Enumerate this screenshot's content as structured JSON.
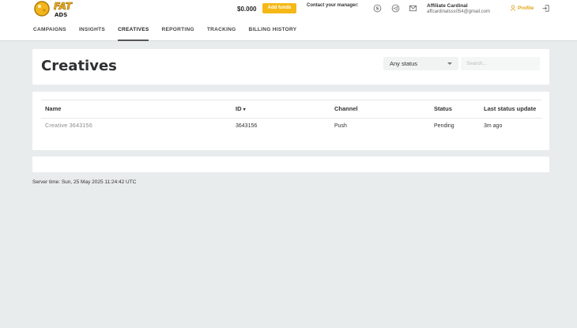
{
  "header": {
    "logo_text": "FAT ADS",
    "balance": "$0.000",
    "add_funds_label": "Add funds",
    "contact_label": "Contact your manager:",
    "affiliate_name": "Affiliate Cardinal",
    "affiliate_email": "affcardinalsss054@gmail.com",
    "profile_label": "Profile",
    "accent_color": "#f5b816"
  },
  "nav": {
    "items": [
      {
        "label": "CAMPAIGNS"
      },
      {
        "label": "INSIGHTS"
      },
      {
        "label": "CREATIVES"
      },
      {
        "label": "REPORTING"
      },
      {
        "label": "TRACKING"
      },
      {
        "label": "BILLING HISTORY"
      }
    ],
    "active": "CREATIVES"
  },
  "page": {
    "title": "Creatives",
    "status_filter": "Any status",
    "search_placeholder": "Search..."
  },
  "table": {
    "columns": [
      "Name",
      "ID",
      "Channel",
      "Status",
      "Last status update"
    ],
    "sort_indicator": "▾",
    "rows": [
      {
        "name": "Creative 3643156",
        "id": "3643156",
        "channel": "Push",
        "status": "Pending",
        "last_update": "3m ago"
      }
    ]
  },
  "footer": {
    "server_time": "Server time: Sun, 25 May 2025 11:24:42 UTC"
  }
}
